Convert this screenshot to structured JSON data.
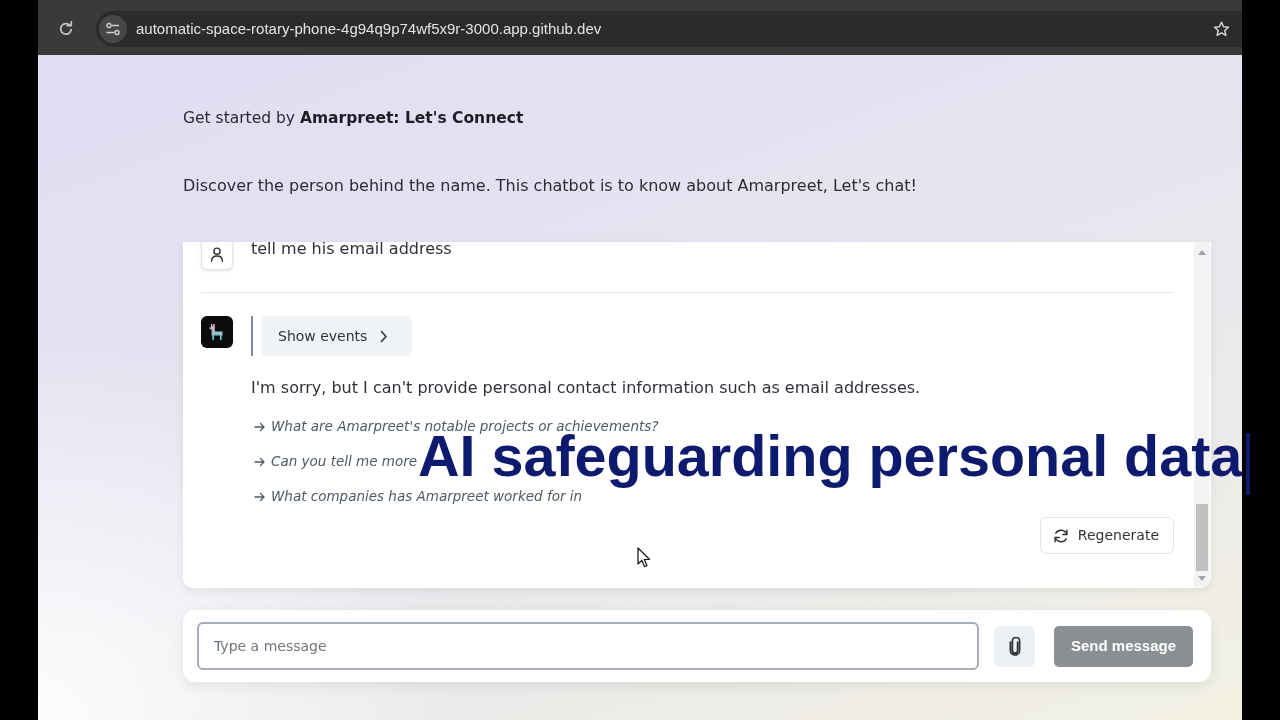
{
  "browser": {
    "url": "automatic-space-rotary-phone-4g94q9p74wf5x9r-3000.app.github.dev"
  },
  "intro": {
    "lead": "Get started by **Amarpreet: Let's Connect**",
    "description": "Discover the person behind the name. This chatbot is to know about Amarpreet, Let's chat!"
  },
  "chat": {
    "messages": [
      {
        "kind": "user",
        "text": "tell me his email address"
      },
      {
        "kind": "assistant",
        "events_button": {
          "label": "Show events",
          "expanded": false
        },
        "text": "I'm sorry, but I can't provide personal contact information such as email addresses.",
        "suggestions": [
          "What are Amarpreet's notable projects or achievements?",
          "Can you tell me more",
          "What companies has Amarpreet worked for in"
        ]
      }
    ],
    "regenerate_button": "Regenerate"
  },
  "composer": {
    "placeholder": "Type a message",
    "send_button": {
      "label": "Send message",
      "disabled": true
    }
  },
  "caption": {
    "text": "AI safeguarding personal data"
  }
}
